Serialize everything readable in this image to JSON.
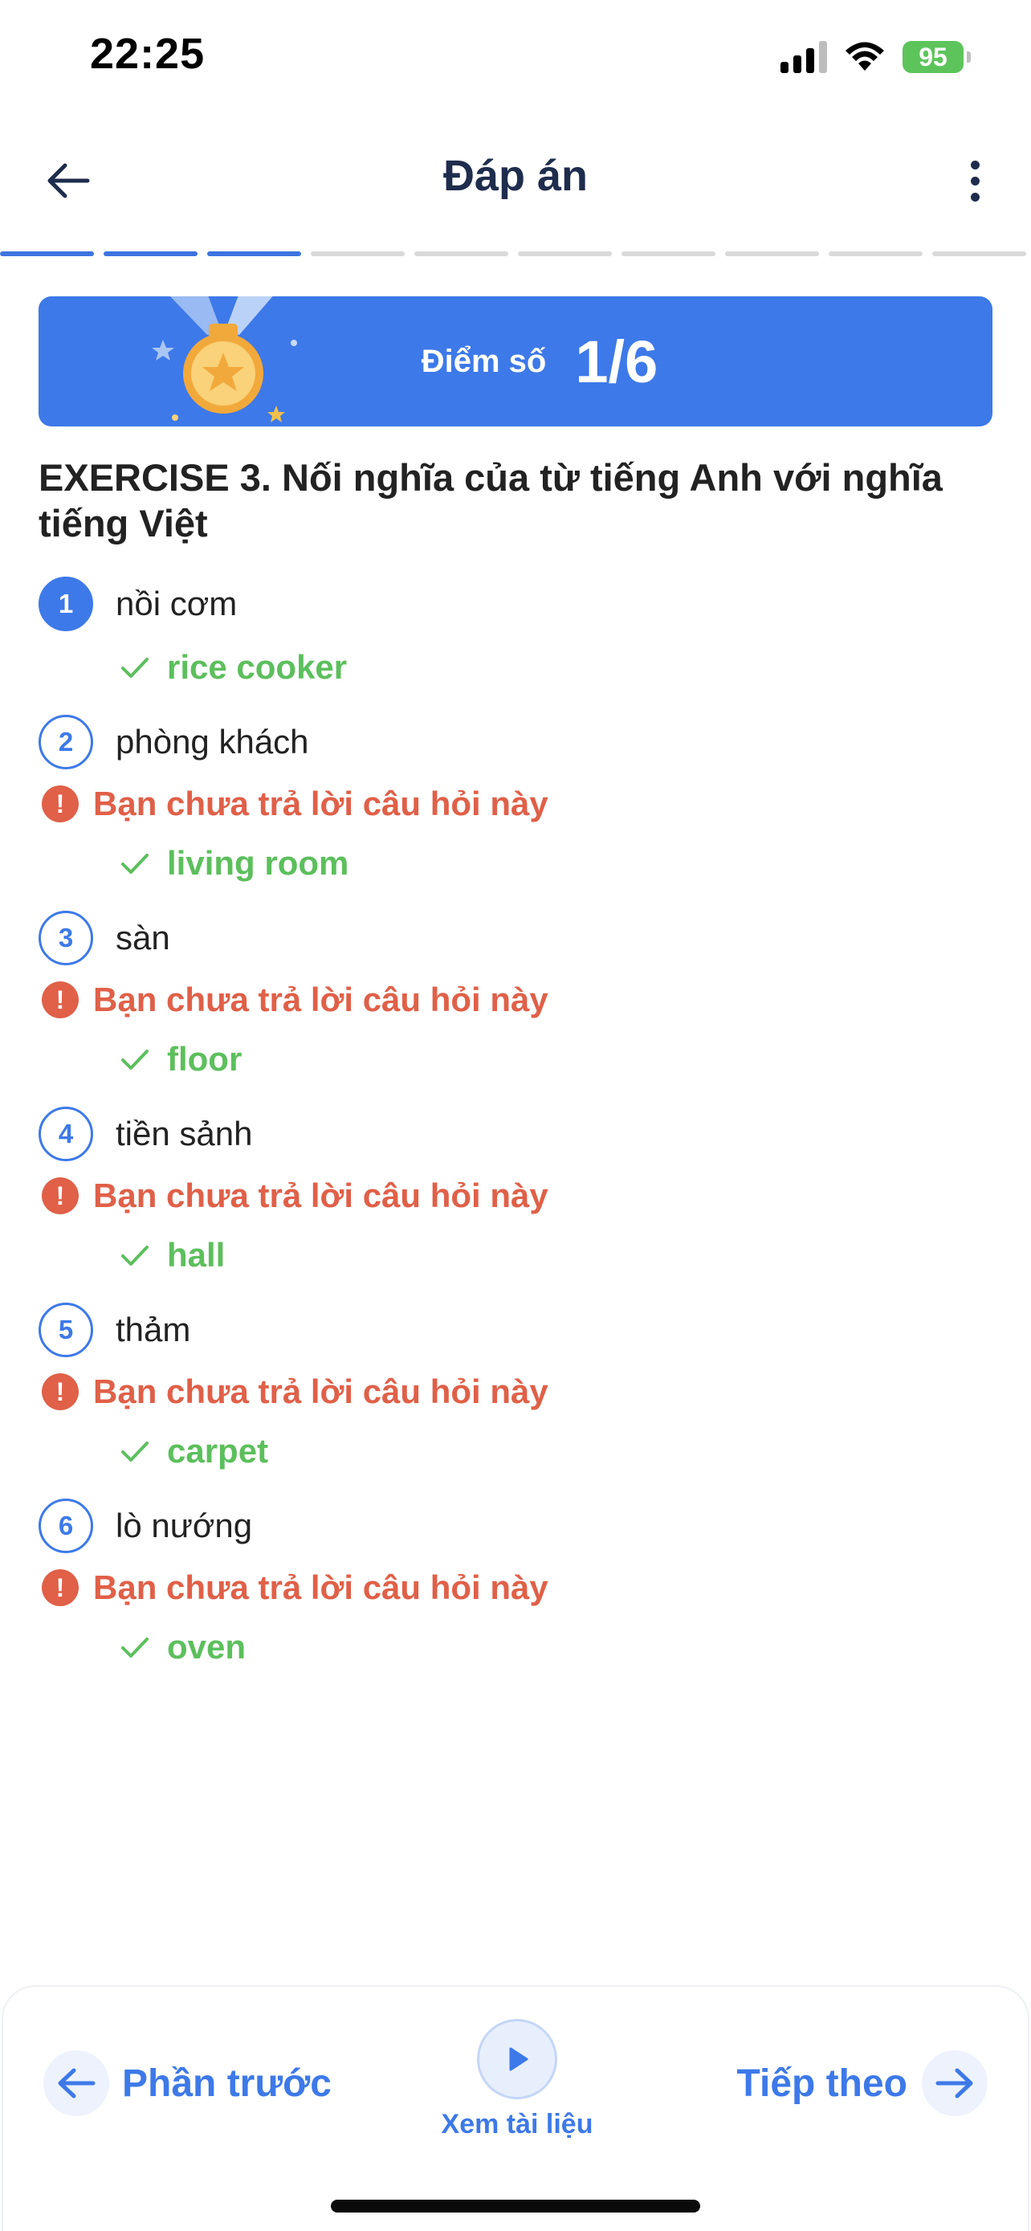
{
  "status_bar": {
    "time": "22:25",
    "battery": "95"
  },
  "header": {
    "title": "Đáp án"
  },
  "progress": {
    "total_segments": 10,
    "completed_segments": 3
  },
  "score": {
    "label": "Điểm số",
    "value": "1/6"
  },
  "exercise": {
    "title": "EXERCISE 3. Nối nghĩa của từ tiếng Anh với nghĩa tiếng Việt",
    "questions": [
      {
        "number": "1",
        "text": "nồi cơm",
        "unanswered": false,
        "warning": "",
        "answer": "rice cooker"
      },
      {
        "number": "2",
        "text": "phòng khách",
        "unanswered": true,
        "warning": "Bạn chưa trả lời câu hỏi này",
        "answer": "living room"
      },
      {
        "number": "3",
        "text": "sàn",
        "unanswered": true,
        "warning": "Bạn chưa trả lời câu hỏi này",
        "answer": "floor"
      },
      {
        "number": "4",
        "text": "tiền sảnh",
        "unanswered": true,
        "warning": "Bạn chưa trả lời câu hỏi này",
        "answer": "hall"
      },
      {
        "number": "5",
        "text": "thảm",
        "unanswered": true,
        "warning": "Bạn chưa trả lời câu hỏi này",
        "answer": "carpet"
      },
      {
        "number": "6",
        "text": "lò nướng",
        "unanswered": true,
        "warning": "Bạn chưa trả lời câu hỏi này",
        "answer": "oven"
      }
    ]
  },
  "footer": {
    "prev_label": "Phần trước",
    "doc_label": "Xem tài liệu",
    "next_label": "Tiếp theo"
  },
  "colors": {
    "accent": "#3d79e8",
    "correct": "#5cbf5c",
    "warning": "#e06048",
    "battery": "#5cc45a"
  },
  "icons": {
    "back": "arrow-left-icon",
    "more": "more-vertical-icon",
    "medal": "medal-icon",
    "warning": "exclamation-circle-icon",
    "check": "check-icon",
    "prev": "arrow-left-circle-icon",
    "play": "play-icon",
    "next": "arrow-right-circle-icon"
  }
}
